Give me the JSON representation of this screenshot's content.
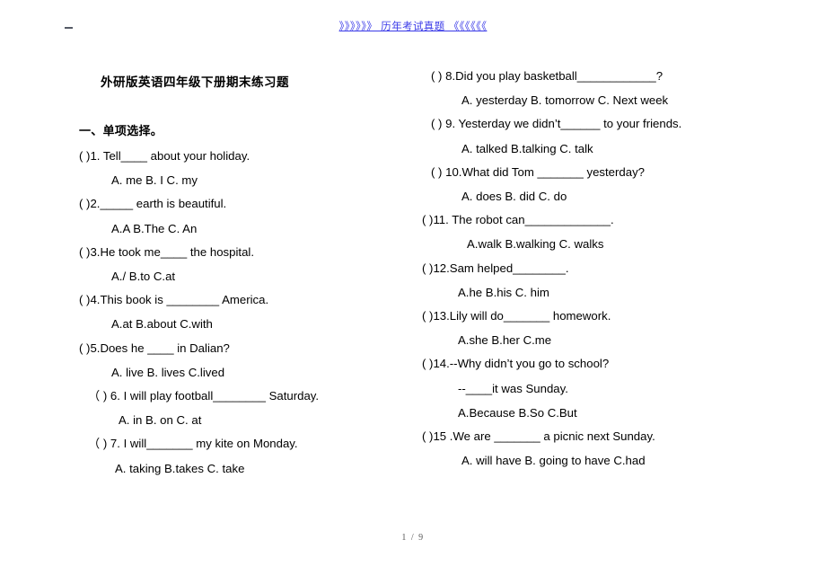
{
  "header": {
    "banner_text": "》》》》》》 历年考试真题 《《《《《《",
    "corner_mark": ""
  },
  "document": {
    "title": "外研版英语四年级下册期末练习题",
    "section_heading": "一、单项选择。"
  },
  "footer": {
    "page_label": "1 / 9"
  },
  "left_column": {
    "questions": [
      {
        "prompt": "(    )1. Tell____ about your holiday.",
        "options": "A. me   B. I  C. my"
      },
      {
        "prompt": "(    )2._____ earth is beautiful.",
        "options": "A.A     B.The  C. An"
      },
      {
        "prompt": "(    )3.He took me____ the hospital.",
        "options": "A./      B.to     C.at"
      },
      {
        "prompt": "(    )4.This book is ________ America.",
        "options": "A.at     B.about   C.with"
      },
      {
        "prompt": "(    )5.Does he ____ in Dalian?",
        "options": "A. live   B. lives   C.lived"
      },
      {
        "prompt": "（   ) 6. I will play football________ Saturday.",
        "options": "A. in    B. on  C. at"
      },
      {
        "prompt": "（   ) 7. I will_______ my kite on Monday.",
        "options": "A. taking    B.takes  C. take"
      }
    ]
  },
  "right_column": {
    "questions": [
      {
        "prompt": "(    ) 8.Did you play basketball____________?",
        "options": "A. yesterday         B. tomorrow    C. Next week"
      },
      {
        "prompt": "(    ) 9. Yesterday we didn’t______ to your friends.",
        "options": "A. talked    B.talking    C. talk"
      },
      {
        "prompt": "(    ) 10.What did Tom _______ yesterday?",
        "options": "A. does    B. did  C. do"
      },
      {
        "prompt": "(    )11. The robot can_____________.",
        "options": "A.walk   B.walking  C. walks"
      },
      {
        "prompt": "(    )12.Sam helped________.",
        "options": "A.he      B.his   C. him"
      },
      {
        "prompt": "(    )13.Lily will do_______ homework.",
        "options": "A.she    B.her    C.me"
      },
      {
        "prompt": "(    )14.--Why didn’t you go to school?",
        "sub": "--____it was Sunday.",
        "options": "A.Because   B.So  C.But"
      },
      {
        "prompt": "(    )15  .We are _______ a picnic next Sunday.",
        "options": "A. will have   B. going to have   C.had"
      }
    ]
  }
}
